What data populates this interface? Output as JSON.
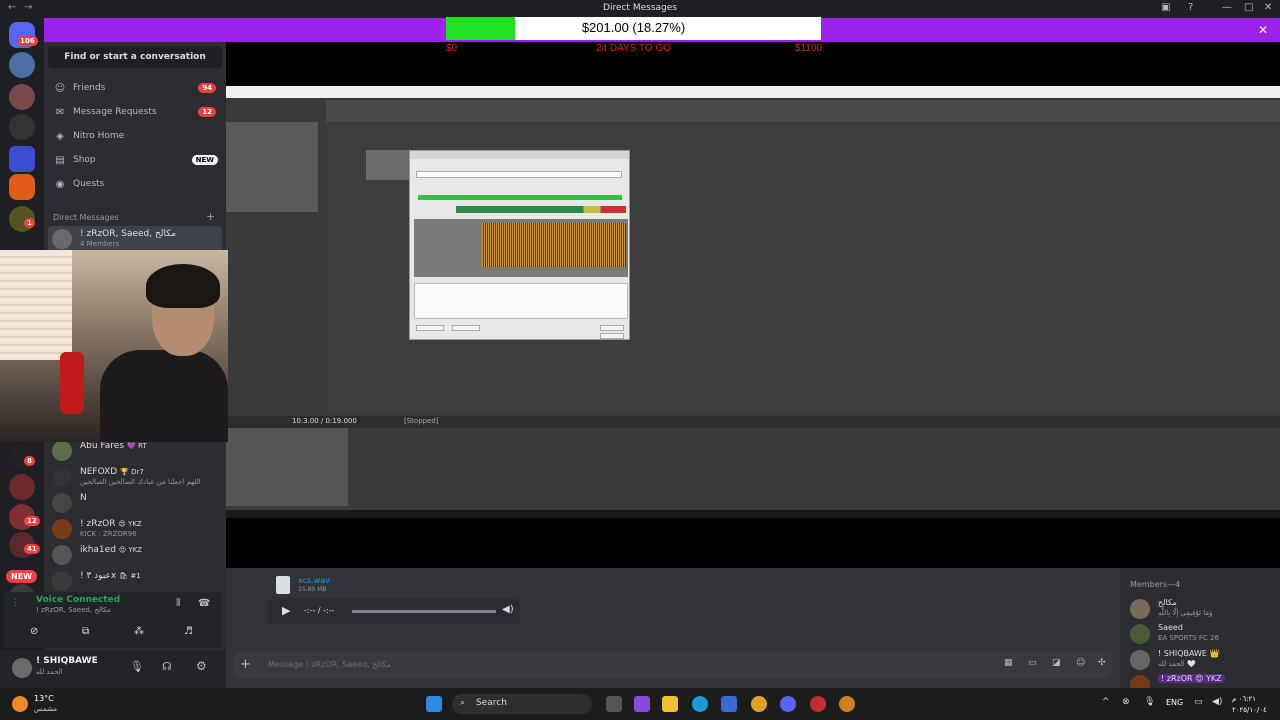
{
  "window": {
    "title": "Direct Messages"
  },
  "overlay": {
    "goal_text": "$201.00 (18.27%)",
    "goal_fraction": 0.1827,
    "min_label": "$0",
    "days_label": "24 DAYS TO GO",
    "max_label": "$1100"
  },
  "rail": {
    "home_badge": "106",
    "badges": [
      "8",
      "1",
      "1",
      "8",
      "12",
      "8",
      "41"
    ],
    "new_pill": "NEW"
  },
  "sidebar": {
    "search_placeholder": "Find or start a conversation",
    "nav": [
      {
        "label": "Friends",
        "icon": "friends-icon",
        "count": "94"
      },
      {
        "label": "Message Requests",
        "icon": "mail-icon",
        "count": "12"
      },
      {
        "label": "Nitro Home",
        "icon": "nitro-icon"
      },
      {
        "label": "Shop",
        "icon": "shop-icon",
        "pill": "NEW"
      },
      {
        "label": "Quests",
        "icon": "quests-icon"
      }
    ],
    "dm_header": "Direct Messages",
    "dms": [
      {
        "name": "! zRzOR, Saeed, مكالح",
        "sub": "4 Members"
      },
      {
        "name": "Abu Fares",
        "tag": "💜 RT"
      },
      {
        "name": "NEFOXD",
        "tag": "🏆 Dr7",
        "sub": "اللهم اجعلنا من عبادك الصالحين الصالحين"
      },
      {
        "name": "N"
      },
      {
        "name": "! zRzOR",
        "tag": "😍 YKZ",
        "sub": "KICK : ZRZOR96"
      },
      {
        "name": "ikha1ed",
        "tag": "😍 YKZ"
      },
      {
        "name": "! عبود ٣x",
        "tag": "🛍 #1"
      }
    ]
  },
  "voice": {
    "status": "Voice Connected",
    "channel": "! zRzOR, Saeed, مكالح"
  },
  "user": {
    "name": "! SHIQBAWE",
    "status": "الحمد لله"
  },
  "daw": {
    "time": "10.3.00 / 0:19.000",
    "state": "[Stopped]"
  },
  "chat": {
    "file_name": "xcs.wav",
    "file_size": "15.80 MB",
    "time": "-:-- / -:--",
    "placeholder": "Message ! zRzOR, Saeed, مكالح"
  },
  "members": {
    "header": "Members—4",
    "list": [
      {
        "name": "مكالح",
        "sub": "وَمَا تَوْفِيقِي إِلَّا بِاللَّهِ"
      },
      {
        "name": "Saeed",
        "sub": "EA SPORTS FC 26",
        "color": "#3ba55c"
      },
      {
        "name": "! SHIQBAWE 👑",
        "sub": "الحمد لله 🤍"
      },
      {
        "name": "! zRzOR 😍 YKZ"
      }
    ]
  },
  "taskbar": {
    "weather_temp": "13°C",
    "weather_text": "مشمس",
    "search": "Search",
    "lang": "ENG",
    "clock_time": "٠٦:٢١ م",
    "clock_date": "٢٠٢٥/١٠/٠٤"
  },
  "colors": {
    "overlay_purple": "#9b22e8",
    "goal_green": "#22e022",
    "discord_red": "#f23f43",
    "voice_green": "#23a559"
  }
}
